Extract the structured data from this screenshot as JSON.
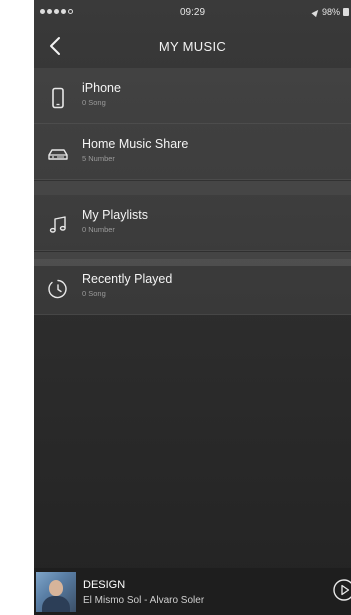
{
  "status_bar": {
    "time": "09:29",
    "battery": "98%"
  },
  "nav": {
    "title": "MY MUSIC"
  },
  "groups": [
    {
      "items": [
        {
          "icon": "phone-icon",
          "title": "iPhone",
          "subtitle": "0 Song"
        },
        {
          "icon": "network-drive-icon",
          "title": "Home Music Share",
          "subtitle": "5 Number"
        }
      ]
    },
    {
      "items": [
        {
          "icon": "music-note-icon",
          "title": "My Playlists",
          "subtitle": "0 Number"
        }
      ]
    },
    {
      "items": [
        {
          "icon": "clock-icon",
          "title": "Recently Played",
          "subtitle": "0 Song"
        }
      ]
    }
  ],
  "now_playing": {
    "title": "DESIGN",
    "subtitle": "El Mismo Sol - Alvaro Soler"
  }
}
